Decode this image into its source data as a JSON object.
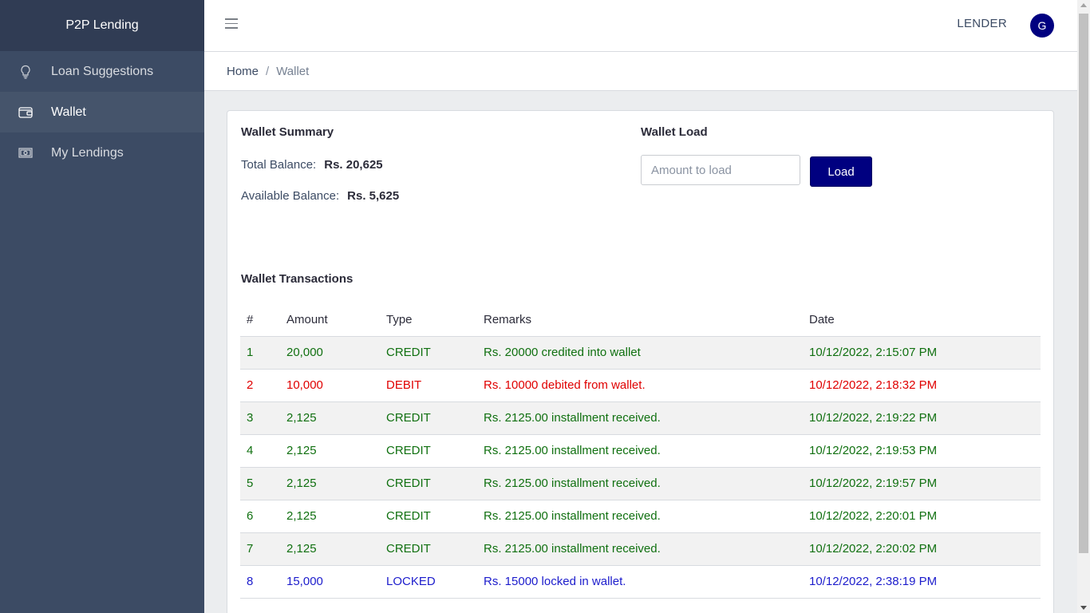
{
  "app": {
    "brand": "P2P Lending"
  },
  "sidebar": {
    "items": [
      {
        "label": "Loan Suggestions",
        "icon": "lightbulb-icon"
      },
      {
        "label": "Wallet",
        "icon": "wallet-icon",
        "active": true
      },
      {
        "label": "My Lendings",
        "icon": "banknote-icon"
      }
    ]
  },
  "header": {
    "role": "LENDER",
    "avatar_initial": "G"
  },
  "breadcrumb": {
    "home": "Home",
    "separator": "/",
    "current": "Wallet"
  },
  "summary": {
    "title": "Wallet Summary",
    "total_label": "Total Balance:",
    "total_value": "Rs. 20,625",
    "available_label": "Available Balance:",
    "available_value": "Rs. 5,625"
  },
  "load": {
    "title": "Wallet Load",
    "placeholder": "Amount to load",
    "button": "Load"
  },
  "transactions": {
    "title": "Wallet Transactions",
    "columns": [
      "#",
      "Amount",
      "Type",
      "Remarks",
      "Date"
    ],
    "rows": [
      {
        "n": "1",
        "amount": "20,000",
        "type": "CREDIT",
        "remarks": "Rs. 20000 credited into wallet",
        "date": "10/12/2022, 2:15:07 PM"
      },
      {
        "n": "2",
        "amount": "10,000",
        "type": "DEBIT",
        "remarks": "Rs. 10000 debited from wallet.",
        "date": "10/12/2022, 2:18:32 PM"
      },
      {
        "n": "3",
        "amount": "2,125",
        "type": "CREDIT",
        "remarks": "Rs. 2125.00 installment received.",
        "date": "10/12/2022, 2:19:22 PM"
      },
      {
        "n": "4",
        "amount": "2,125",
        "type": "CREDIT",
        "remarks": "Rs. 2125.00 installment received.",
        "date": "10/12/2022, 2:19:53 PM"
      },
      {
        "n": "5",
        "amount": "2,125",
        "type": "CREDIT",
        "remarks": "Rs. 2125.00 installment received.",
        "date": "10/12/2022, 2:19:57 PM"
      },
      {
        "n": "6",
        "amount": "2,125",
        "type": "CREDIT",
        "remarks": "Rs. 2125.00 installment received.",
        "date": "10/12/2022, 2:20:01 PM"
      },
      {
        "n": "7",
        "amount": "2,125",
        "type": "CREDIT",
        "remarks": "Rs. 2125.00 installment received.",
        "date": "10/12/2022, 2:20:02 PM"
      },
      {
        "n": "8",
        "amount": "15,000",
        "type": "LOCKED",
        "remarks": "Rs. 15000 locked in wallet.",
        "date": "10/12/2022, 2:38:19 PM"
      }
    ]
  },
  "colors": {
    "sidebar_bg": "#3c4b64",
    "brand_bg": "#303c54",
    "accent": "#000080",
    "credit": "#107010",
    "debit": "#e00000",
    "locked": "#1c1ccc"
  }
}
